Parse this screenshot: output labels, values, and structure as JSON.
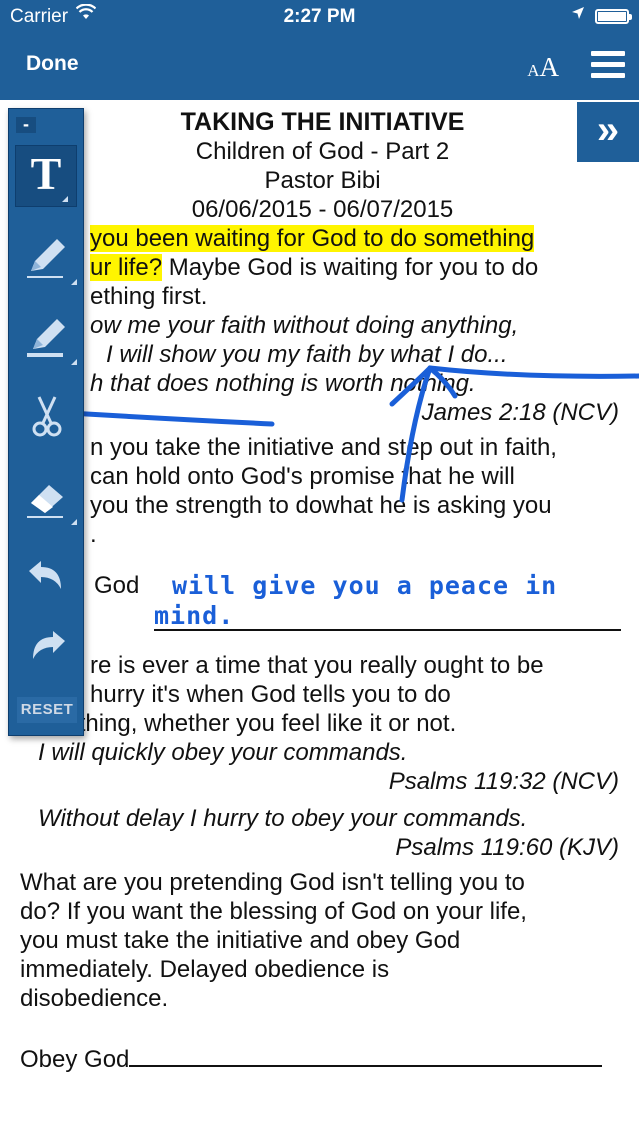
{
  "status_bar": {
    "carrier": "Carrier",
    "time": "2:27 PM"
  },
  "nav": {
    "done_label": "Done",
    "text_size_small": "A",
    "text_size_big": "A",
    "menu_icon": "hamburger-icon"
  },
  "toolbar": {
    "collapse_label": "-",
    "text_tool": "T",
    "reset_label": "RESET",
    "tools": [
      "text-tool-icon",
      "pen-icon",
      "highlighter-icon",
      "scissors-icon",
      "eraser-icon",
      "undo-icon",
      "redo-icon"
    ]
  },
  "expand_label": "»",
  "document": {
    "title": "TAKING THE INITIATIVE",
    "subtitle": "Children of God - Part 2",
    "pastor": "Pastor Bibi",
    "dates": "06/06/2015 - 06/07/2015",
    "p1_highlight_a": "you been waiting for God to do something",
    "p1_highlight_b": "ur life?",
    "p1_rest_a": " Maybe God is waiting for you to do",
    "p1_line3": "ething first.",
    "q1_line1": "ow me your faith without doing anything,",
    "q1_line2": "I will show you my faith by what I do...",
    "q1_line3": "h that does nothing is worth nothing.",
    "q1_ref": "James 2:18 (NCV)",
    "p2_line1": "n you take the initiative and step out in faith,",
    "p2_line2": "can hold onto God's promise that he will",
    "p2_line3": "you the strength to dowhat he is asking you",
    "p2_line4": ".",
    "blank1_prefix": "God",
    "handwriting_1": "will give you a peace in",
    "handwriting_2": "mind.",
    "p3_line1": "re is ever a time that you really ought to be",
    "p3_line2": "hurry it's when God tells you to do",
    "p3_line3": "something, whether you feel like it or not.",
    "q2_text": "I will quickly obey your commands.",
    "q2_ref": "Psalms 119:32 (NCV)",
    "q3_text": "Without delay I hurry to obey your commands.",
    "q3_ref": "Psalms 119:60 (KJV)",
    "p4": [
      "What are you pretending God isn't telling you to",
      "do? If you want the blessing of God on your life,",
      "you must take the initiative and obey God",
      "immediately. Delayed obedience is",
      "disobedience."
    ],
    "blank2_prefix": "Obey God"
  },
  "colors": {
    "nav_blue": "#1f5f99",
    "highlight": "#fff500",
    "ink": "#1a5fd8"
  }
}
